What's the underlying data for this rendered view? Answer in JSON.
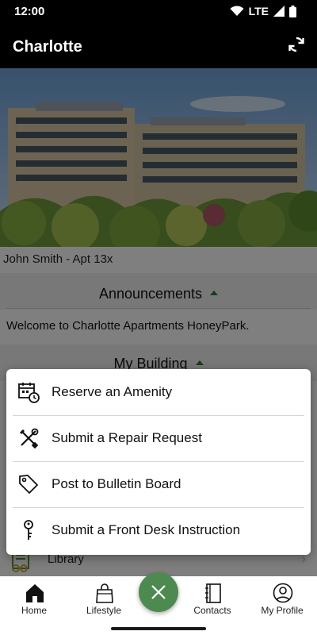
{
  "status_bar": {
    "time": "12:00",
    "network": "LTE"
  },
  "app_bar": {
    "title": "Charlotte"
  },
  "resident": {
    "name_unit": "John Smith - Apt 13x"
  },
  "announcements": {
    "title": "Announcements",
    "message": "Welcome to Charlotte Apartments HoneyPark."
  },
  "my_building": {
    "title": "My Building"
  },
  "library": {
    "label": "Library"
  },
  "action_sheet": {
    "items": [
      {
        "label": "Reserve an Amenity",
        "icon": "calendar-clock-icon"
      },
      {
        "label": "Submit a Repair Request",
        "icon": "tools-icon"
      },
      {
        "label": "Post to Bulletin Board",
        "icon": "tag-icon"
      },
      {
        "label": "Submit a Front Desk Instruction",
        "icon": "key-icon"
      }
    ]
  },
  "bottom_nav": {
    "items": [
      {
        "label": "Home",
        "icon": "home-icon",
        "active": true
      },
      {
        "label": "Lifestyle",
        "icon": "shopping-bag-icon"
      },
      {
        "label": "Contacts",
        "icon": "address-book-icon"
      },
      {
        "label": "My Profile",
        "icon": "profile-icon"
      }
    ],
    "fab_icon": "close-icon"
  },
  "colors": {
    "accent_green": "#4d8a4f",
    "caret_green": "#2e7d32",
    "app_bar": "#000000"
  }
}
